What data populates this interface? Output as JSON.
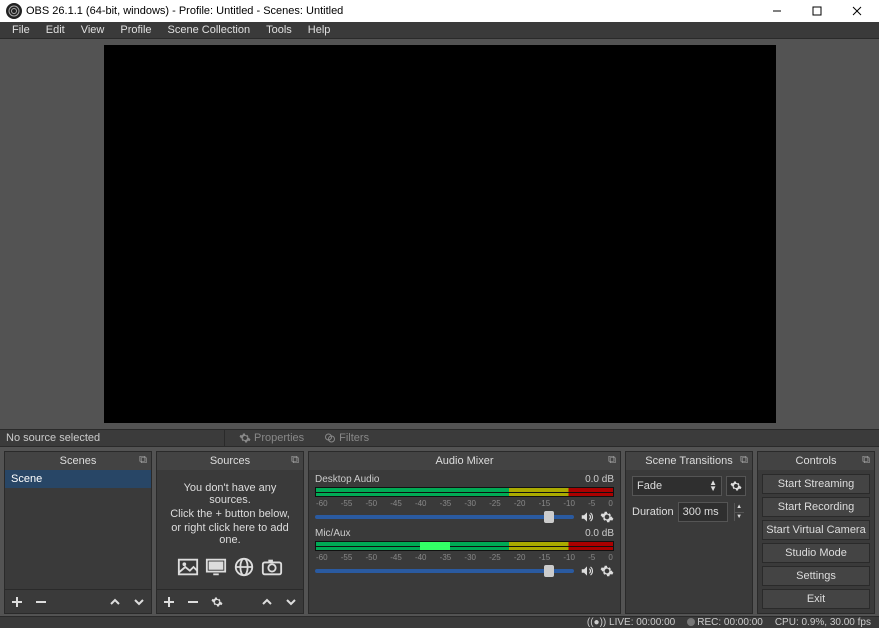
{
  "titlebar": {
    "title": "OBS 26.1.1 (64-bit, windows) - Profile: Untitled - Scenes: Untitled"
  },
  "menu": {
    "items": [
      "File",
      "Edit",
      "View",
      "Profile",
      "Scene Collection",
      "Tools",
      "Help"
    ]
  },
  "source_toolbar": {
    "status": "No source selected",
    "properties": "Properties",
    "filters": "Filters"
  },
  "docks": {
    "scenes": {
      "title": "Scenes",
      "items": [
        "Scene"
      ]
    },
    "sources": {
      "title": "Sources",
      "empty_line1": "You don't have any sources.",
      "empty_line2": "Click the + button below,",
      "empty_line3": "or right click here to add one."
    },
    "mixer": {
      "title": "Audio Mixer",
      "channels": [
        {
          "name": "Desktop Audio",
          "level": "0.0 dB",
          "ticks": [
            "-60",
            "-55",
            "-50",
            "-45",
            "-40",
            "-35",
            "-30",
            "-25",
            "-20",
            "-15",
            "-10",
            "-5",
            "0"
          ]
        },
        {
          "name": "Mic/Aux",
          "level": "0.0 dB",
          "ticks": [
            "-60",
            "-55",
            "-50",
            "-45",
            "-40",
            "-35",
            "-30",
            "-25",
            "-20",
            "-15",
            "-10",
            "-5",
            "0"
          ]
        }
      ]
    },
    "transitions": {
      "title": "Scene Transitions",
      "selected": "Fade",
      "duration_label": "Duration",
      "duration_value": "300 ms"
    },
    "controls": {
      "title": "Controls",
      "buttons": [
        "Start Streaming",
        "Start Recording",
        "Start Virtual Camera",
        "Studio Mode",
        "Settings",
        "Exit"
      ]
    }
  },
  "statusbar": {
    "live": "LIVE: 00:00:00",
    "rec": "REC: 00:00:00",
    "cpu": "CPU: 0.9%, 30.00 fps"
  }
}
